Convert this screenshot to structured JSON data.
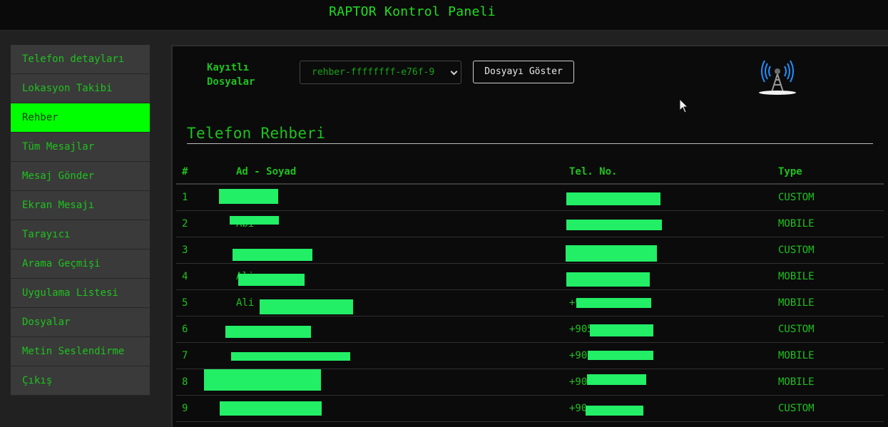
{
  "header": {
    "title": "RAPTOR Kontrol Paneli"
  },
  "sidebar": {
    "items": [
      {
        "label": "Telefon detayları",
        "active": false
      },
      {
        "label": "Lokasyon Takibi",
        "active": false
      },
      {
        "label": "Rehber",
        "active": true
      },
      {
        "label": "Tüm Mesajlar",
        "active": false
      },
      {
        "label": "Mesaj Gönder",
        "active": false
      },
      {
        "label": "Ekran Mesajı",
        "active": false
      },
      {
        "label": "Tarayıcı",
        "active": false
      },
      {
        "label": "Arama Geçmişi",
        "active": false
      },
      {
        "label": "Uygulama Listesi",
        "active": false
      },
      {
        "label": "Dosyalar",
        "active": false
      },
      {
        "label": "Metin Seslendirme",
        "active": false
      },
      {
        "label": "Çıkış",
        "active": false
      }
    ]
  },
  "files": {
    "label": "Kayıtlı\nDosyalar",
    "selected": "rehber-ffffffff-e76f-9",
    "button_label": "Dosyayı Göster"
  },
  "section": {
    "title": "Telefon Rehberi"
  },
  "table": {
    "headers": {
      "num": "#",
      "name": "Ad - Soyad",
      "phone": "Tel. No.",
      "type": "Type"
    },
    "rows": [
      {
        "num": "1",
        "name": "",
        "phone": "",
        "type": "CUSTOM"
      },
      {
        "num": "2",
        "name": "Abi",
        "phone": "",
        "type": "MOBILE"
      },
      {
        "num": "3",
        "name": "",
        "phone": "",
        "type": "CUSTOM"
      },
      {
        "num": "4",
        "name": "Ali",
        "phone": "",
        "type": "MOBILE"
      },
      {
        "num": "5",
        "name": "Ali",
        "phone": "+9",
        "type": "MOBILE"
      },
      {
        "num": "6",
        "name": "",
        "phone": "+905",
        "type": "CUSTOM"
      },
      {
        "num": "7",
        "name": "",
        "phone": "+90",
        "type": "MOBILE"
      },
      {
        "num": "8",
        "name": "",
        "phone": "+90",
        "type": "MOBILE"
      },
      {
        "num": "9",
        "name": "",
        "phone": "+90",
        "type": "CUSTOM"
      }
    ]
  },
  "colors": {
    "accent": "#1ec21e",
    "active_bg": "#00ff00",
    "redaction": "#22ee66"
  },
  "icons": {
    "antenna": "radio-tower-icon",
    "cursor": "mouse-pointer-icon",
    "select": "chevron-down-icon"
  }
}
